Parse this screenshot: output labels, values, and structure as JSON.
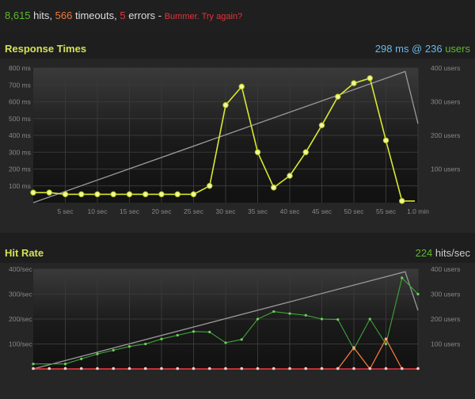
{
  "summary": {
    "hits": "8,615",
    "hits_label": "hits,",
    "timeouts": "566",
    "timeouts_label": "timeouts,",
    "errors": "5",
    "errors_label": "errors -",
    "message": "Bummer. Try again?"
  },
  "response": {
    "title": "Response Times",
    "stat_ms": "298",
    "stat_ms_unit": "ms @",
    "stat_users": "236",
    "stat_users_unit": "users"
  },
  "hitrate": {
    "title": "Hit Rate",
    "stat_hits": "224",
    "stat_unit": "hits/sec"
  },
  "colors": {
    "yellow": "#d8e830",
    "green": "#3fa53a",
    "orange": "#f0793a",
    "red": "#e2343d",
    "users_line": "#9a9a9a"
  },
  "chart_data": [
    {
      "type": "line",
      "name": "response-times",
      "x_ticks": [
        "5 sec",
        "10 sec",
        "15 sec",
        "20 sec",
        "25 sec",
        "30 sec",
        "35 sec",
        "40 sec",
        "45 sec",
        "50 sec",
        "55 sec",
        "1.0 min"
      ],
      "x_tick_values": [
        5,
        10,
        15,
        20,
        25,
        30,
        35,
        40,
        45,
        50,
        55,
        60
      ],
      "xlim": [
        0,
        60
      ],
      "y_ticks": [
        "100 ms",
        "200 ms",
        "300 ms",
        "400 ms",
        "500 ms",
        "600 ms",
        "700 ms",
        "800 ms"
      ],
      "y_tick_values": [
        100,
        200,
        300,
        400,
        500,
        600,
        700,
        800
      ],
      "ylim": [
        0,
        800
      ],
      "y2_ticks": [
        "100 users",
        "200 users",
        "300 users",
        "400 users"
      ],
      "y2_tick_values": [
        100,
        200,
        300,
        400
      ],
      "y2lim": [
        0,
        400
      ],
      "grid": true,
      "series": [
        {
          "role": "response_ms",
          "points": [
            [
              0,
              60
            ],
            [
              2.5,
              60
            ],
            [
              5,
              50
            ],
            [
              7.5,
              50
            ],
            [
              10,
              50
            ],
            [
              12.5,
              50
            ],
            [
              15,
              50
            ],
            [
              17.5,
              50
            ],
            [
              20,
              50
            ],
            [
              22.5,
              50
            ],
            [
              25,
              50
            ],
            [
              27.5,
              100
            ],
            [
              30,
              580
            ],
            [
              32.5,
              690
            ],
            [
              35,
              300
            ],
            [
              37.5,
              90
            ],
            [
              40,
              160
            ],
            [
              42.5,
              300
            ],
            [
              45,
              460
            ],
            [
              47.5,
              630
            ],
            [
              50,
              710
            ],
            [
              52.5,
              740
            ],
            [
              55,
              370
            ],
            [
              57.5,
              10
            ],
            [
              59.5,
              10
            ]
          ]
        },
        {
          "role": "users",
          "points": [
            [
              0,
              0
            ],
            [
              58,
              390
            ],
            [
              60,
              235
            ]
          ]
        }
      ]
    },
    {
      "type": "line",
      "name": "hit-rate",
      "x_tick_values": [
        5,
        10,
        15,
        20,
        25,
        30,
        35,
        40,
        45,
        50,
        55,
        60
      ],
      "xlim": [
        0,
        60
      ],
      "y_ticks": [
        "100/sec",
        "200/sec",
        "300/sec",
        "400/sec"
      ],
      "y_tick_values": [
        100,
        200,
        300,
        400
      ],
      "ylim": [
        0,
        400
      ],
      "y2_ticks": [
        "100 users",
        "200 users",
        "300 users",
        "400 users"
      ],
      "y2_tick_values": [
        100,
        200,
        300,
        400
      ],
      "y2lim": [
        0,
        400
      ],
      "grid": true,
      "series": [
        {
          "role": "hits",
          "points": [
            [
              0,
              20
            ],
            [
              5,
              20
            ],
            [
              7.5,
              40
            ],
            [
              10,
              60
            ],
            [
              12.5,
              75
            ],
            [
              15,
              90
            ],
            [
              17.5,
              100
            ],
            [
              20,
              120
            ],
            [
              22.5,
              135
            ],
            [
              25,
              150
            ],
            [
              27.5,
              148
            ],
            [
              30,
              105
            ],
            [
              32.5,
              118
            ],
            [
              35,
              200
            ],
            [
              37.5,
              230
            ],
            [
              40,
              222
            ],
            [
              42.5,
              215
            ],
            [
              45,
              200
            ],
            [
              47.5,
              198
            ],
            [
              50,
              80
            ],
            [
              52.5,
              200
            ],
            [
              55,
              100
            ],
            [
              57.5,
              365
            ],
            [
              60,
              300
            ]
          ]
        },
        {
          "role": "timeouts",
          "points": [
            [
              0,
              0
            ],
            [
              47.5,
              0
            ],
            [
              50,
              85
            ],
            [
              52.5,
              0
            ],
            [
              55,
              120
            ],
            [
              57.5,
              0
            ],
            [
              60,
              0
            ]
          ]
        },
        {
          "role": "errors",
          "points": [
            [
              0,
              0
            ],
            [
              2.5,
              0
            ],
            [
              5,
              0
            ],
            [
              7.5,
              0
            ],
            [
              10,
              0
            ],
            [
              12.5,
              0
            ],
            [
              15,
              0
            ],
            [
              17.5,
              0
            ],
            [
              20,
              0
            ],
            [
              22.5,
              0
            ],
            [
              25,
              0
            ],
            [
              27.5,
              0
            ],
            [
              30,
              0
            ],
            [
              32.5,
              0
            ],
            [
              35,
              0
            ],
            [
              37.5,
              0
            ],
            [
              40,
              0
            ],
            [
              42.5,
              0
            ],
            [
              45,
              0
            ],
            [
              47.5,
              0
            ],
            [
              50,
              0
            ],
            [
              52.5,
              0
            ],
            [
              55,
              0
            ],
            [
              57.5,
              0
            ],
            [
              60,
              0
            ]
          ]
        },
        {
          "role": "users",
          "points": [
            [
              0,
              0
            ],
            [
              58,
              390
            ],
            [
              60,
              235
            ]
          ]
        }
      ]
    }
  ]
}
